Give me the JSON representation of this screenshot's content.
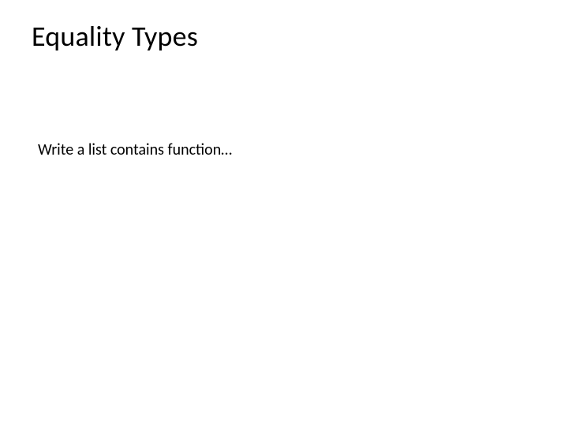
{
  "slide": {
    "title": "Equality Types",
    "body": "Write a list contains function…"
  }
}
